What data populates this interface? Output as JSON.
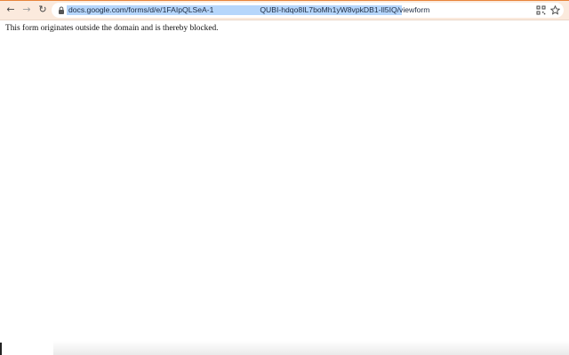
{
  "browser": {
    "toolbar": {
      "back_glyph": "←",
      "forward_glyph": "→",
      "reload_glyph": "↻"
    },
    "omnibox": {
      "url_part1": "docs.google.com/forms/d/e/1FAIpQLSeA-1",
      "url_part2": "QUBI-hdqo8IL7boMh1yW8vpkDB1-Il5IQ/viewform",
      "icons": [
        "lock-icon",
        "qr-code-icon",
        "star-icon"
      ]
    }
  },
  "page": {
    "message": "This form originates outside the domain and is thereby blocked."
  }
}
